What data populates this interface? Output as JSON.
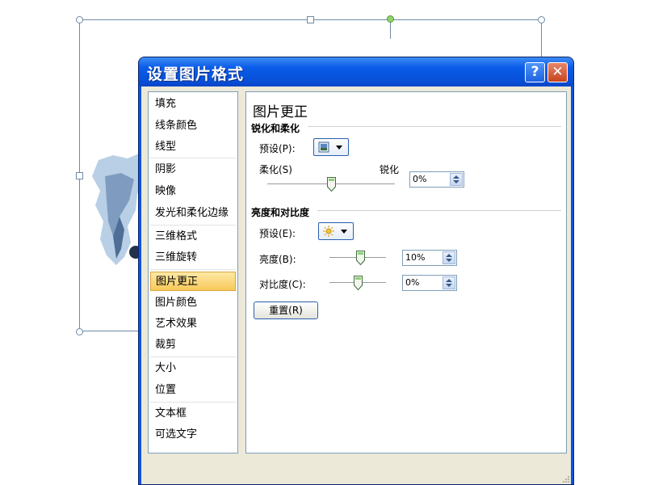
{
  "dialog": {
    "title": "设置图片格式",
    "help_glyph": "?",
    "close_glyph": "✕",
    "close_button": "关闭"
  },
  "sidebar": {
    "items": [
      {
        "label": "填充"
      },
      {
        "label": "线条颜色"
      },
      {
        "label": "线型"
      },
      {
        "label": "阴影"
      },
      {
        "label": "映像"
      },
      {
        "label": "发光和柔化边缘"
      },
      {
        "label": "三维格式"
      },
      {
        "label": "三维旋转"
      },
      {
        "label": "图片更正",
        "selected": true
      },
      {
        "label": "图片颜色"
      },
      {
        "label": "艺术效果"
      },
      {
        "label": "裁剪"
      },
      {
        "label": "大小"
      },
      {
        "label": "位置"
      },
      {
        "label": "文本框"
      },
      {
        "label": "可选文字"
      }
    ]
  },
  "panel": {
    "heading": "图片更正",
    "sharpen": {
      "group_label": "锐化和柔化",
      "preset_label": "预设(P):",
      "soften_label": "柔化(S)",
      "sharpen_label": "锐化",
      "value": "0%",
      "slider_fraction": 0.5
    },
    "brightness_contrast": {
      "group_label": "亮度和对比度",
      "preset_label": "预设(E):",
      "brightness_label": "亮度(B):",
      "brightness_value": "10%",
      "brightness_fraction": 0.55,
      "contrast_label": "对比度(C):",
      "contrast_value": "0%",
      "contrast_fraction": 0.5
    },
    "reset_button": "重置(R)"
  },
  "colors": {
    "title_bar": "#0a5ce8",
    "dialog_face": "#ece9d8",
    "selection": "#f8c95a"
  },
  "icons": [
    "question-icon",
    "close-icon",
    "preset-sharpen-icon",
    "preset-brightness-icon",
    "chevron-down-icon"
  ]
}
